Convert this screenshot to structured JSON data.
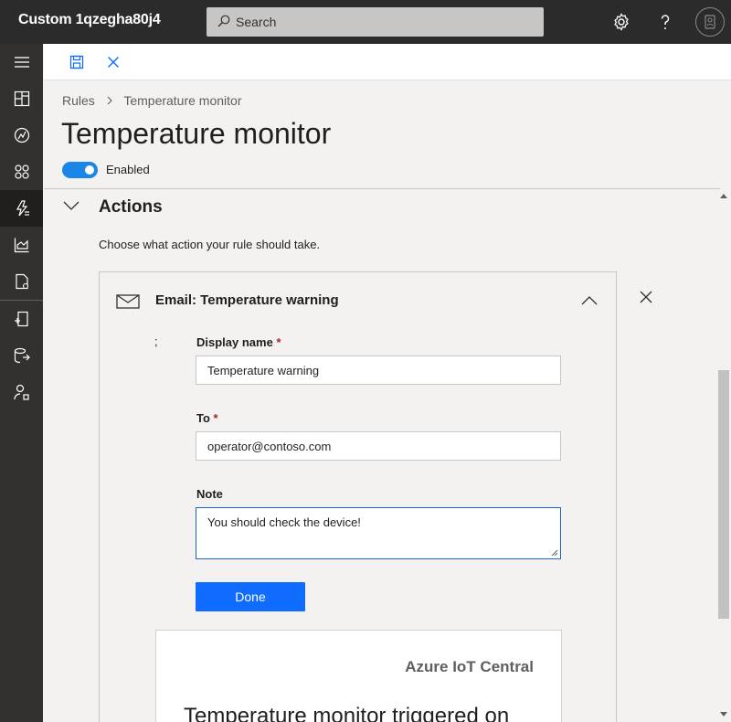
{
  "app": {
    "title": "Custom 1qzegha80j4"
  },
  "search": {
    "placeholder": "Search"
  },
  "topbar_icons": [
    "gear-icon",
    "help-icon",
    "user-avatar-icon"
  ],
  "leftnav": {
    "items": [
      {
        "icon": "hamburger-icon"
      },
      {
        "icon": "dashboard-icon"
      },
      {
        "icon": "device-icon"
      },
      {
        "icon": "device-groups-icon"
      },
      {
        "icon": "rules-icon",
        "active": true
      },
      {
        "icon": "analytics-icon"
      },
      {
        "icon": "jobs-icon"
      },
      {
        "icon": "device-templates-icon"
      },
      {
        "icon": "data-export-icon"
      },
      {
        "icon": "administration-icon"
      }
    ]
  },
  "commandbar": {
    "icons": [
      "save-icon",
      "discard-icon"
    ]
  },
  "breadcrumb": {
    "root": "Rules",
    "current": "Temperature monitor"
  },
  "page": {
    "title": "Temperature monitor",
    "enabled_label": "Enabled",
    "enabled": true
  },
  "actions": {
    "title": "Actions",
    "description": "Choose what action your rule should take.",
    "card": {
      "title": "Email: Temperature warning",
      "stray": ";",
      "display_name_label": "Display name",
      "display_name_value": "Temperature warning",
      "to_label": "To",
      "to_value": "operator@contoso.com",
      "note_label": "Note",
      "note_value": "You should check the device!",
      "required_mark": "*",
      "done_label": "Done",
      "preview": {
        "brand": "Azure IoT Central",
        "heading": "Temperature monitor triggered on"
      }
    }
  },
  "colors": {
    "topbar": "#2b2b2b",
    "leftnav": "#323130",
    "accent": "#0f6cff",
    "toggle": "#1a86e8"
  }
}
